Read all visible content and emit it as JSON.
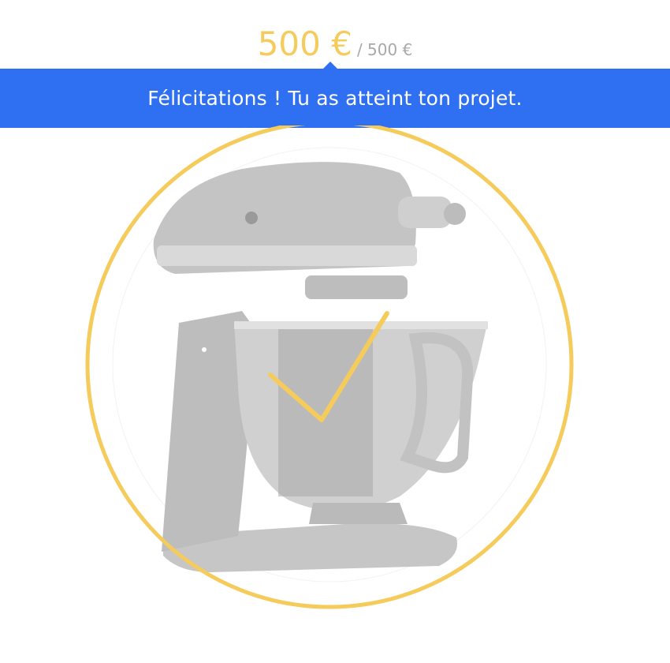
{
  "project": {
    "amount_saved": "500 €",
    "amount_goal": "/ 500 €",
    "progress": 1.0
  },
  "banner": {
    "message": "Félicitations ! Tu as atteint ton projet."
  },
  "product": {
    "icon": "stand-mixer-image"
  },
  "status": {
    "icon": "checkmark-icon",
    "completed": true
  },
  "colors": {
    "accent": "#f5cb5c",
    "banner": "#2f6ff2",
    "muted_text": "#a8a8a8",
    "product_gray": "#c9c9c9"
  }
}
